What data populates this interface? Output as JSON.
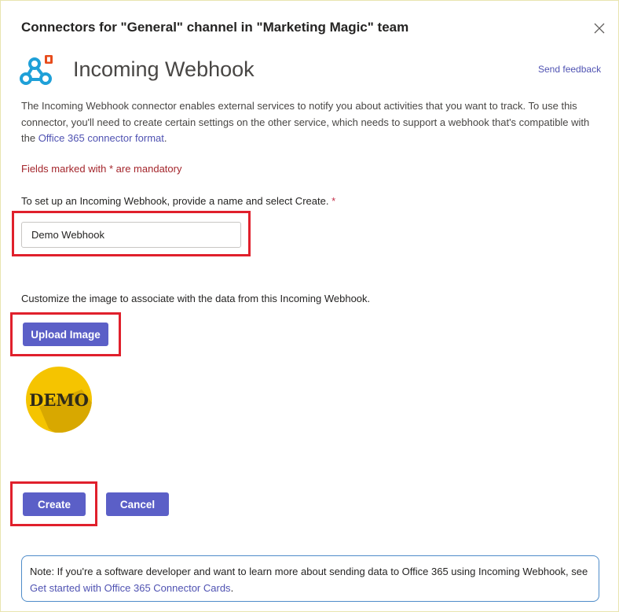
{
  "dialog": {
    "title": "Connectors for \"General\" channel in \"Marketing Magic\" team",
    "close_icon": "close-icon"
  },
  "connector": {
    "icon": "webhook-icon",
    "name": "Incoming Webhook",
    "feedback_link": "Send feedback"
  },
  "description": {
    "text": "The Incoming Webhook connector enables external services to notify you about activities that you want to track. To use this connector, you'll need to create certain settings on the other service, which needs to support a webhook that's compatible with the ",
    "link": "Office 365 connector format",
    "suffix": "."
  },
  "mandatory_note": "Fields marked with * are mandatory",
  "name_field": {
    "label": "To set up an Incoming Webhook, provide a name and select Create.",
    "required_marker": "*",
    "value": "Demo Webhook"
  },
  "image_section": {
    "label": "Customize the image to associate with the data from this Incoming Webhook.",
    "upload_button": "Upload Image",
    "preview_text": "DEMO"
  },
  "actions": {
    "create": "Create",
    "cancel": "Cancel"
  },
  "note": {
    "text": "Note: If you're a software developer and want to learn more about sending data to Office 365 using Incoming Webhook, see ",
    "link": "Get started with Office 365 Connector Cards",
    "suffix": "."
  },
  "colors": {
    "accent": "#5b5fc7",
    "link": "#4f52b2",
    "highlight": "#e0202c",
    "mandatory": "#a4262c",
    "logo_yellow": "#f5c400",
    "webhook_blue": "#1fa0d8"
  }
}
